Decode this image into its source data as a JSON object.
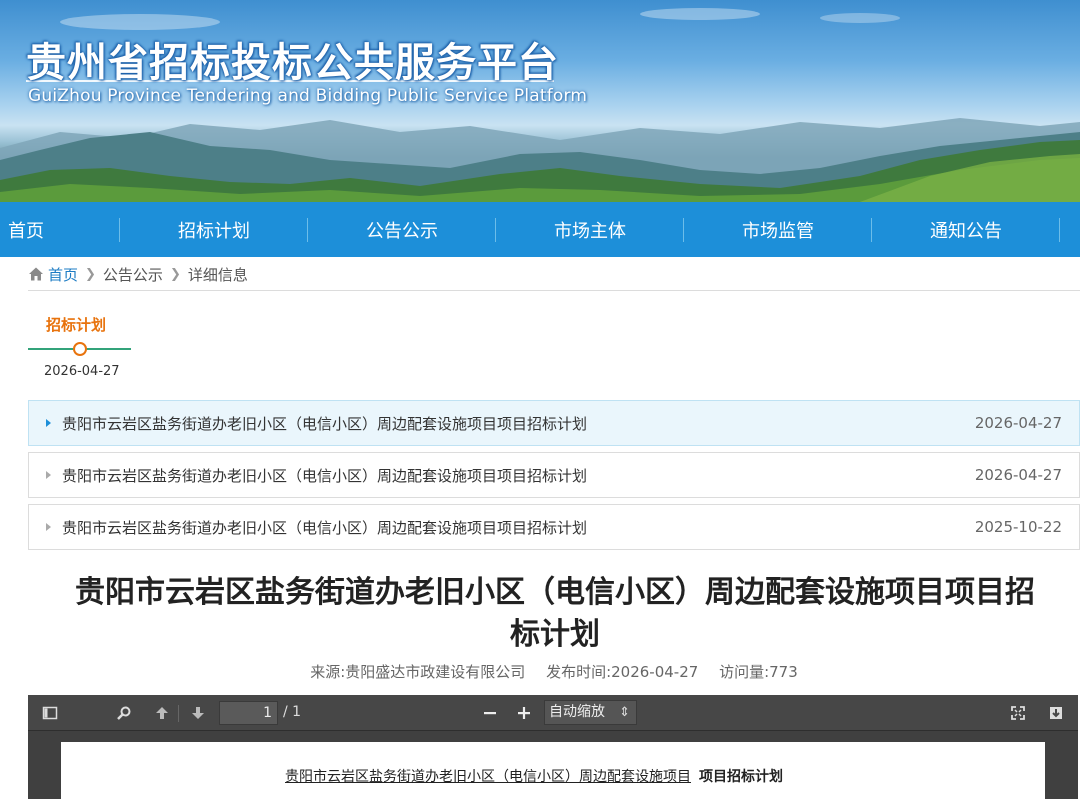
{
  "header": {
    "title": "贵州省招标投标公共服务平台",
    "subtitle": "GuiZhou Province Tendering and Bidding Public Service Platform"
  },
  "nav": {
    "items": [
      {
        "label": "首页"
      },
      {
        "label": "招标计划"
      },
      {
        "label": "公告公示"
      },
      {
        "label": "市场主体"
      },
      {
        "label": "市场监管"
      },
      {
        "label": "通知公告"
      }
    ]
  },
  "breadcrumb": {
    "home": "首页",
    "level1": "公告公示",
    "level2": "详细信息"
  },
  "timeline": {
    "label": "招标计划",
    "date": "2026-04-27"
  },
  "related": [
    {
      "title": "贵阳市云岩区盐务街道办老旧小区（电信小区）周边配套设施项目项目招标计划",
      "date": "2026-04-27",
      "active": true
    },
    {
      "title": "贵阳市云岩区盐务街道办老旧小区（电信小区）周边配套设施项目项目招标计划",
      "date": "2026-04-27",
      "active": false
    },
    {
      "title": "贵阳市云岩区盐务街道办老旧小区（电信小区）周边配套设施项目项目招标计划",
      "date": "2025-10-22",
      "active": false
    }
  ],
  "article": {
    "title_line1": "贵阳市云岩区盐务街道办老旧小区（电信小区）周边配套设施项目项目招",
    "title_line2": "标计划",
    "source": "来源:贵阳盛达市政建设有限公司",
    "publish_time": "发布时间:2026-04-27",
    "views": "访问量:773"
  },
  "pdf_viewer": {
    "page_current": "1",
    "page_total": "/ 1",
    "zoom": "自动缩放",
    "doc_title_underlined": "贵阳市云岩区盐务街道办老旧小区（电信小区）周边配套设施项目",
    "doc_title_bold": "项目招标计划"
  },
  "colors": {
    "nav_bg": "#1d8fd9",
    "accent_orange": "#e8730d",
    "timeline_green": "#33a37a",
    "active_row_bg": "#eaf6fc"
  }
}
